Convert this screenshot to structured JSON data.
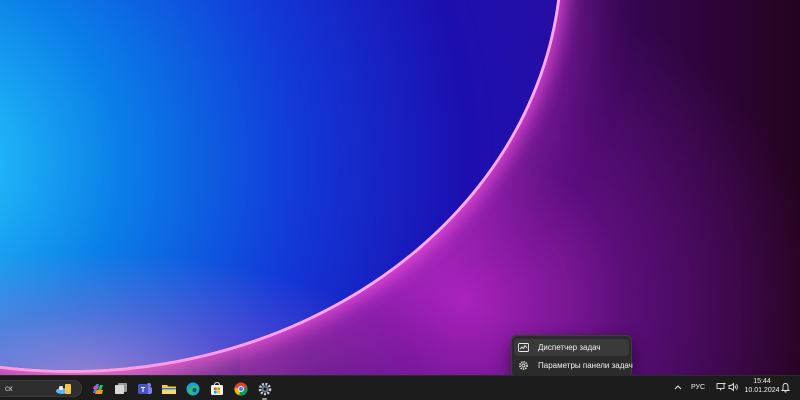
{
  "context_menu": {
    "items": [
      {
        "label": "Диспетчер задач",
        "icon": "task-manager-icon"
      },
      {
        "label": "Параметры панели задач",
        "icon": "gear-icon"
      }
    ]
  },
  "taskbar": {
    "search_text": "ск",
    "apps": [
      {
        "name": "copilot",
        "icon": "copilot-icon"
      },
      {
        "name": "task-view",
        "icon": "task-view-icon"
      },
      {
        "name": "teams",
        "icon": "teams-icon",
        "letter": "T"
      },
      {
        "name": "file-explorer",
        "icon": "folder-icon"
      },
      {
        "name": "edge",
        "icon": "edge-icon"
      },
      {
        "name": "microsoft-store",
        "icon": "store-icon"
      },
      {
        "name": "chrome",
        "icon": "chrome-icon"
      },
      {
        "name": "settings",
        "icon": "gear-icon",
        "running": true
      }
    ],
    "tray": {
      "language": "РУС",
      "time": "15:44",
      "date": "10.01.2024"
    }
  },
  "colors": {
    "taskbar_bg": "#1c1c1c",
    "menu_bg": "#2b2b2b",
    "accent": "#0078d4"
  }
}
